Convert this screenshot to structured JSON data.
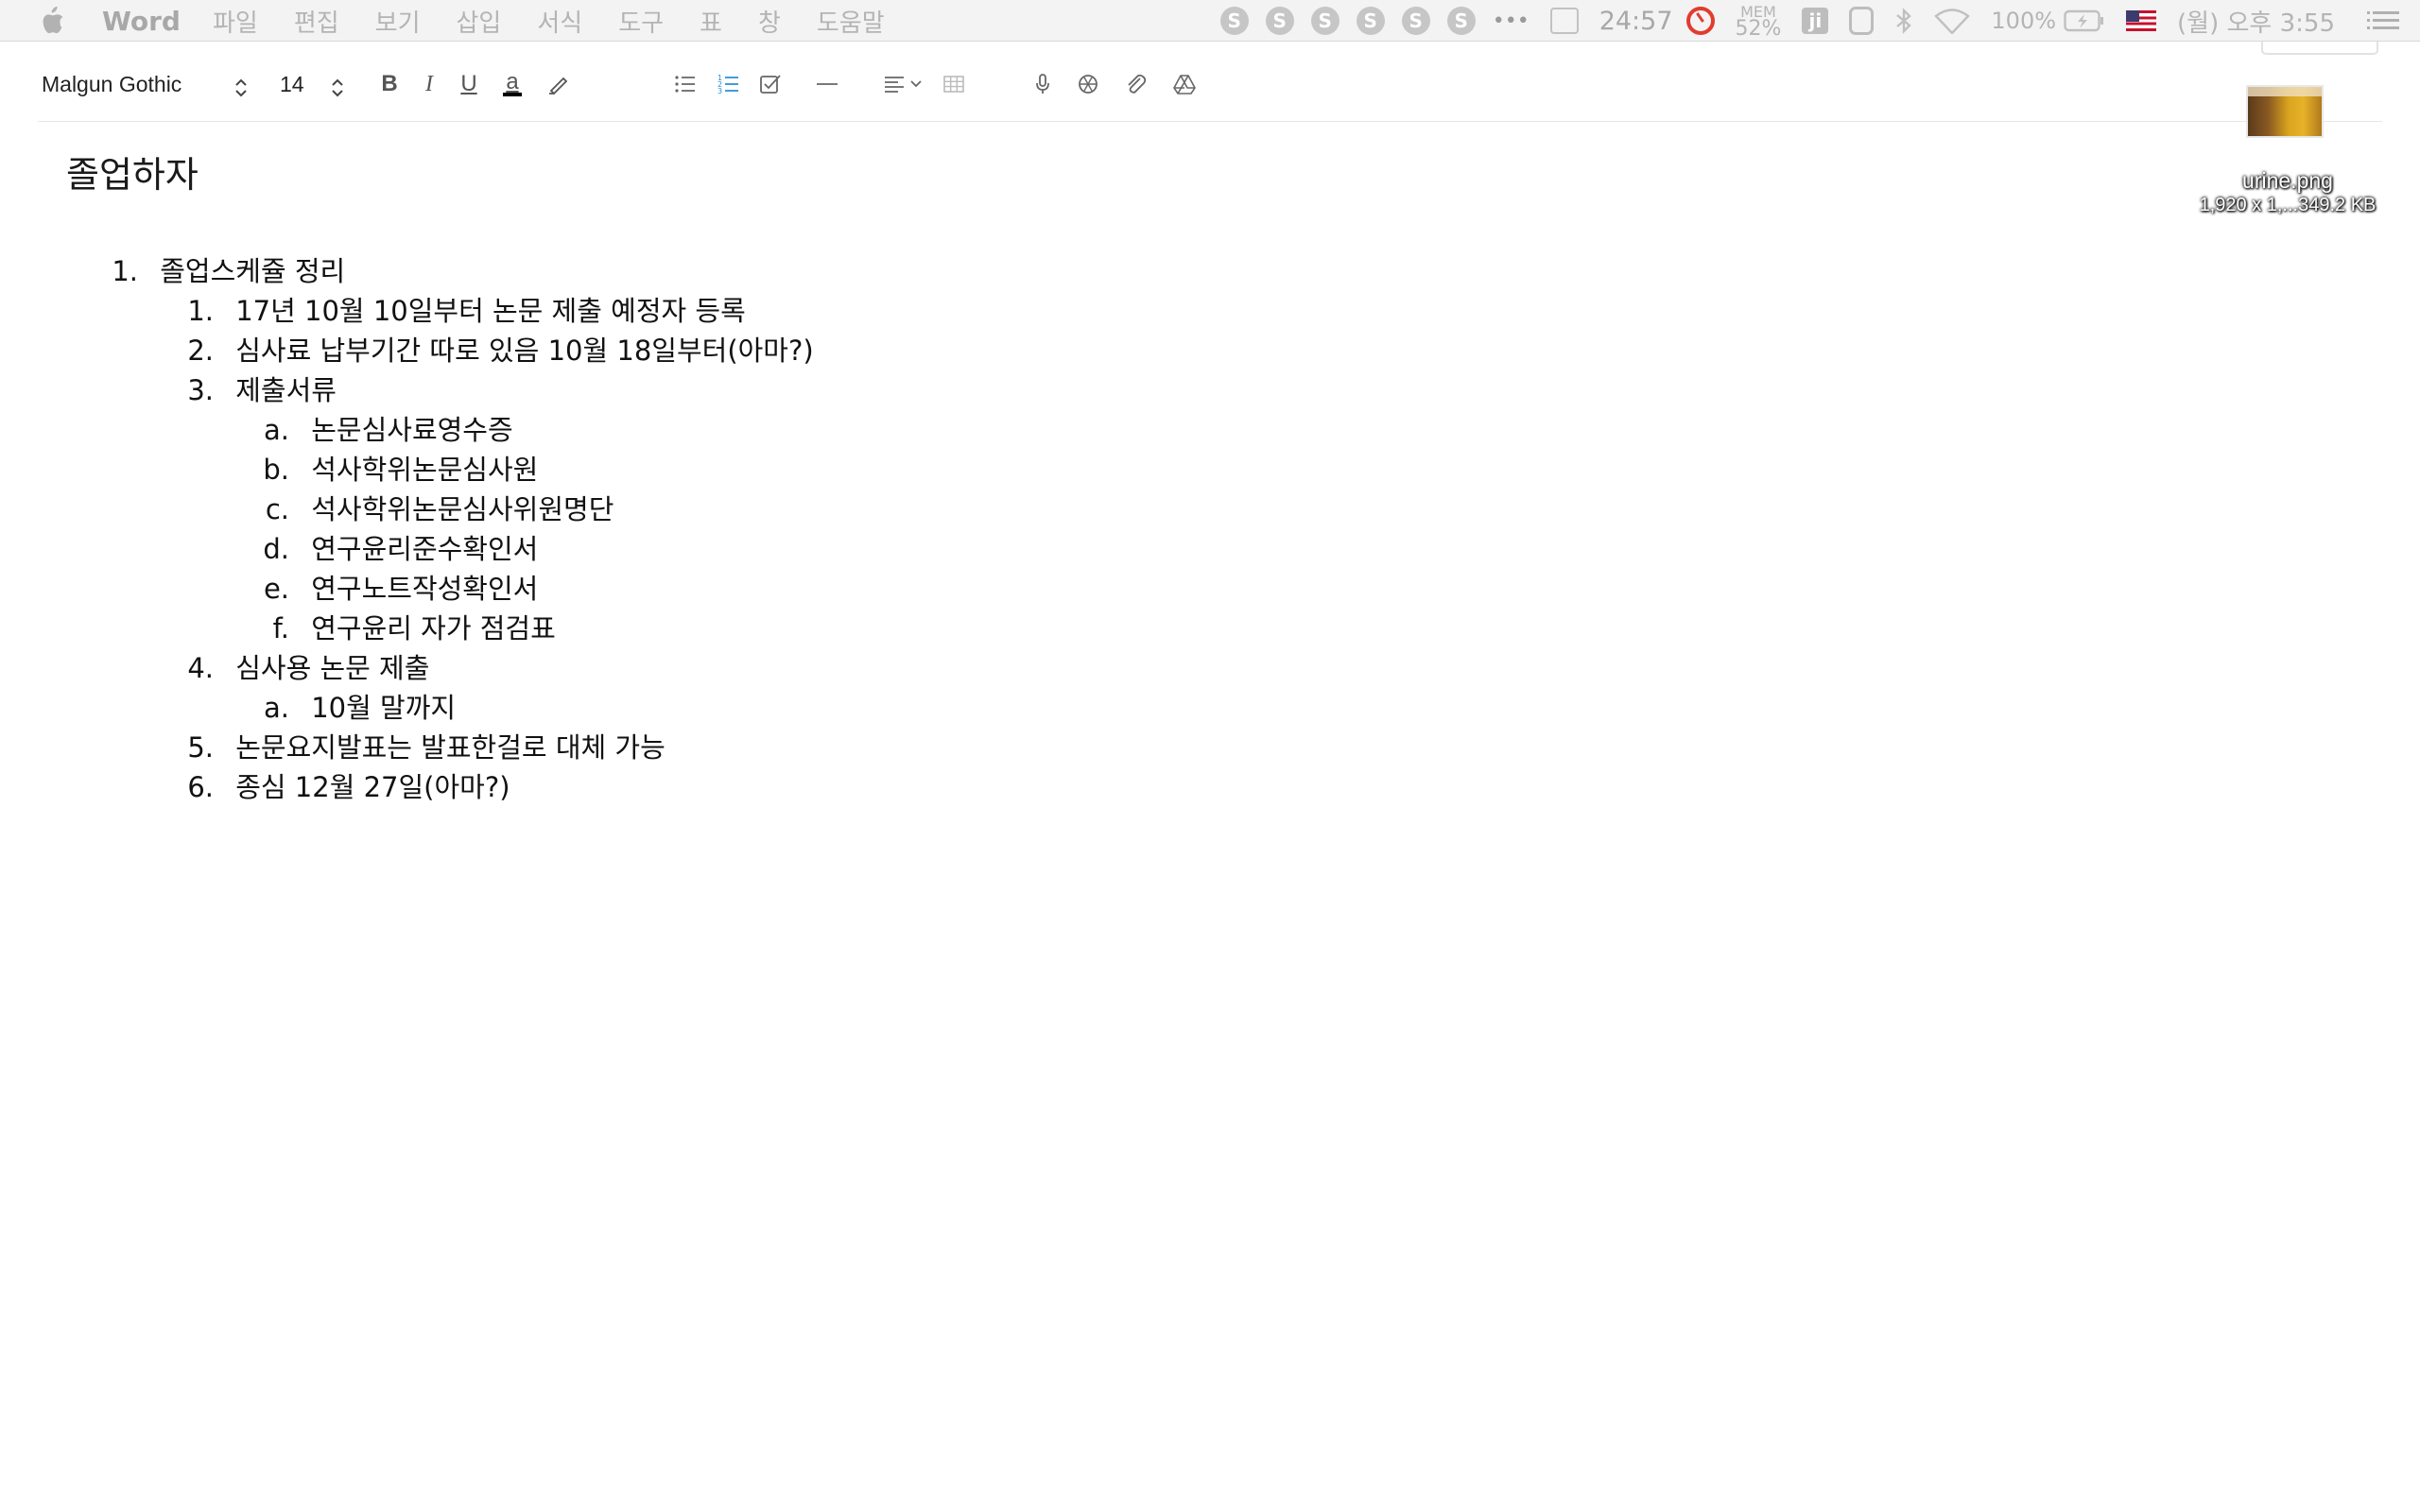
{
  "menubar": {
    "app": "Word",
    "menus": [
      "파일",
      "편집",
      "보기",
      "삽입",
      "서식",
      "도구",
      "표",
      "창",
      "도움말"
    ],
    "coin_glyph": "S",
    "more": "•••",
    "timer": "24:57",
    "mem_label": "MEM",
    "mem_value": "52%",
    "ji_label": "ji",
    "battery": "100%",
    "clock": "(월) 오후 3:55",
    "icons": [
      "apple-icon",
      "s-coin-icon",
      "more-icon",
      "edit-note-icon",
      "stopwatch-icon",
      "ji-icon",
      "evernote-icon",
      "bluetooth-icon",
      "wifi-icon",
      "battery-icon",
      "us-flag-icon",
      "list-icon"
    ]
  },
  "toolbar": {
    "font_name": "Malgun Gothic",
    "font_size": "14",
    "bold": "B",
    "italic": "I",
    "underline": "U",
    "font_color": "a",
    "icons": [
      "highlighter-icon",
      "bulleted-list-icon",
      "numbered-list-icon",
      "checkbox-icon",
      "horizontal-rule-icon",
      "align-icon",
      "table-icon",
      "microphone-icon",
      "camera-icon",
      "paperclip-icon",
      "drive-icon"
    ],
    "accent_color": "#2a8fd6"
  },
  "attachment": {
    "name": "urine.png",
    "meta": "1,920 x 1,...349.2 KB"
  },
  "document": {
    "title": "졸업하자",
    "items": [
      {
        "num": "1.",
        "text": "졸업스케쥴 정리"
      },
      {
        "num": "1.",
        "text": "17년 10월 10일부터 논문 제출 예정자 등록"
      },
      {
        "num": "2.",
        "text": "심사료 납부기간 따로 있음 10월 18일부터(아마?)"
      },
      {
        "num": "3.",
        "text": "제출서류"
      },
      {
        "num": "a.",
        "text": "논문심사료영수증"
      },
      {
        "num": "b.",
        "text": "석사학위논문심사원"
      },
      {
        "num": "c.",
        "text": "석사학위논문심사위원명단"
      },
      {
        "num": "d.",
        "text": "연구윤리준수확인서"
      },
      {
        "num": "e.",
        "text": "연구노트작성확인서"
      },
      {
        "num": "f.",
        "text": "연구윤리 자가 점검표"
      },
      {
        "num": "4.",
        "text": "심사용 논문 제출"
      },
      {
        "num": "a.",
        "text": "10월 말까지"
      },
      {
        "num": "5.",
        "text": "논문요지발표는 발표한걸로 대체 가능"
      },
      {
        "num": "6.",
        "text": "종심 12월 27일(아마?)"
      }
    ]
  }
}
